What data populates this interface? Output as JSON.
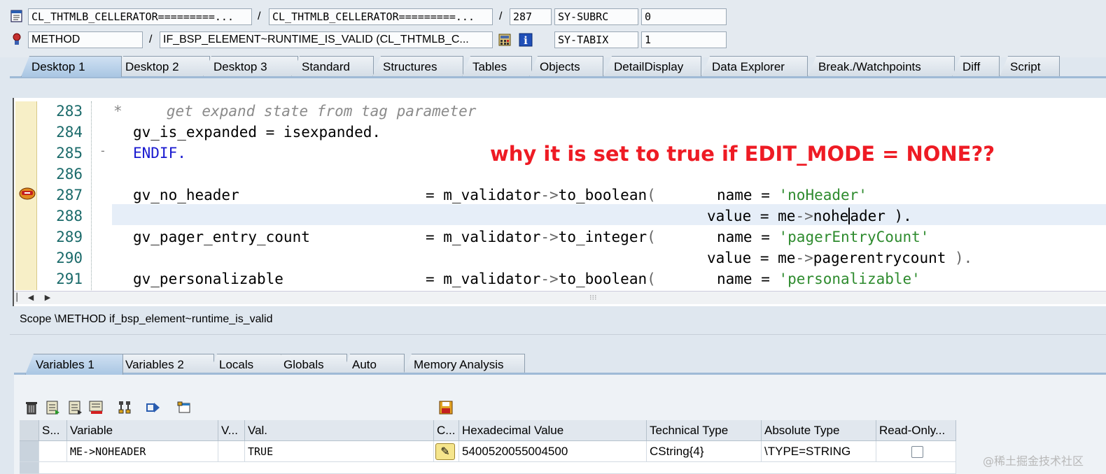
{
  "header": {
    "row1": {
      "program": "CL_THTMLB_CELLERATOR=========...",
      "include": "CL_THTMLB_CELLERATOR=========...",
      "line": "287",
      "sysfield": "SY-SUBRC",
      "sysvalue": "0",
      "separator": "/"
    },
    "row2": {
      "event_type": "METHOD",
      "event_name": "IF_BSP_ELEMENT~RUNTIME_IS_VALID (CL_THTMLB_C...",
      "sysfield": "SY-TABIX",
      "sysvalue": "1",
      "separator": "/"
    }
  },
  "tabs": [
    {
      "label": "Desktop 1"
    },
    {
      "label": "Desktop 2"
    },
    {
      "label": "Desktop 3"
    },
    {
      "label": "Standard"
    },
    {
      "label": "Structures"
    },
    {
      "label": "Tables"
    },
    {
      "label": "Objects"
    },
    {
      "label": "DetailDisplay"
    },
    {
      "label": "Data Explorer"
    },
    {
      "label": "Break./Watchpoints"
    },
    {
      "label": "Diff"
    },
    {
      "label": "Script"
    }
  ],
  "code": {
    "lines": [
      {
        "num": "283",
        "text": "*     get expand state from tag parameter"
      },
      {
        "num": "284",
        "text": "   gv_is_expanded = isexpanded."
      },
      {
        "num": "285",
        "text": "  ENDIF."
      },
      {
        "num": "286",
        "text": ""
      },
      {
        "num": "287",
        "a": "  gv_no_header",
        "b": "= m_validator->to_boolean(",
        "c": "name = ",
        "d": "'noHeader'"
      },
      {
        "num": "288",
        "c": "value = me->noheader ).",
        "d": ""
      },
      {
        "num": "289",
        "a": "  gv_pager_entry_count",
        "b": "= m_validator->to_integer(",
        "c": "name = ",
        "d": "'pagerEntryCount'"
      },
      {
        "num": "290",
        "c": "value = me->pagerentrycount ).",
        "d": ""
      },
      {
        "num": "291",
        "a": "  gv_personalizable",
        "b": "= m_validator->to_boolean(",
        "c": "name = ",
        "d": "'personalizable'"
      }
    ],
    "annotation": "why it is set to true if EDIT_MODE = NONE??"
  },
  "scope": "Scope \\METHOD if_bsp_element~runtime_is_valid",
  "var_tabs": [
    {
      "label": "Variables 1"
    },
    {
      "label": "Variables 2"
    },
    {
      "label": "Locals"
    },
    {
      "label": "Globals"
    },
    {
      "label": "Auto"
    },
    {
      "label": "Memory Analysis"
    }
  ],
  "toolbar_icons": [
    "delete-icon",
    "insert-icon",
    "insert-all-icon",
    "delete-all-icon",
    "hierarchy-icon",
    "transfer-icon",
    "window-icon",
    "save-icon"
  ],
  "table": {
    "headers": [
      "S...",
      "Variable",
      "V...",
      "Val.",
      "C...",
      "Hexadecimal Value",
      "Technical Type",
      "Absolute Type",
      "Read-Only..."
    ],
    "rows": [
      {
        "variable": "ME->NOHEADER",
        "value": "TRUE",
        "hex": "5400520055004500",
        "tech_type": "CString{4}",
        "abs_type": "\\TYPE=STRING",
        "read_only": false
      }
    ]
  },
  "watermark": "@稀土掘金技术社区",
  "colors": {
    "annotation": "#ee1b24",
    "active_tab": "#bcd4ec",
    "string": "#2e8b2e",
    "keyword": "#1a1ad0"
  }
}
